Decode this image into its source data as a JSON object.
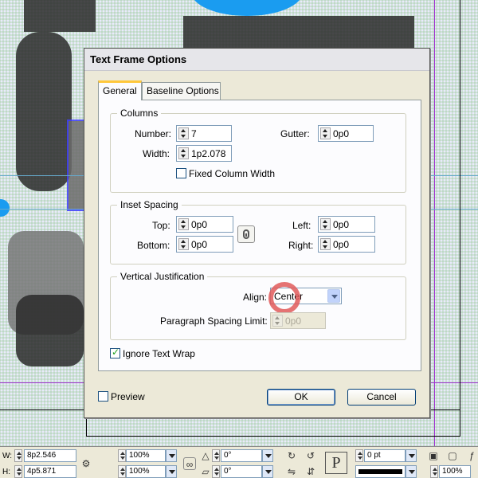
{
  "dialog": {
    "title": "Text Frame Options",
    "tabs": [
      {
        "label": "General",
        "active": true
      },
      {
        "label": "Baseline Options",
        "active": false
      }
    ],
    "columns": {
      "title": "Columns",
      "number_label": "Number:",
      "number_value": "7",
      "width_label": "Width:",
      "width_value": "1p2.078",
      "gutter_label": "Gutter:",
      "gutter_value": "0p0",
      "fixed_width_label": "Fixed Column Width",
      "fixed_width_checked": false
    },
    "inset": {
      "title": "Inset Spacing",
      "top_label": "Top:",
      "top_value": "0p0",
      "bottom_label": "Bottom:",
      "bottom_value": "0p0",
      "left_label": "Left:",
      "left_value": "0p0",
      "right_label": "Right:",
      "right_value": "0p0"
    },
    "vertical": {
      "title": "Vertical Justification",
      "align_label": "Align:",
      "align_value": "Center",
      "para_limit_label": "Paragraph Spacing Limit:",
      "para_limit_value": "0p0"
    },
    "ignore_wrap_label": "Ignore Text Wrap",
    "ignore_wrap_checked": true,
    "preview_label": "Preview",
    "preview_checked": false,
    "ok_label": "OK",
    "cancel_label": "Cancel"
  },
  "control_bar": {
    "w_label": "W:",
    "w_value": "8p2.546",
    "h_label": "H:",
    "h_value": "4p5.871",
    "scale_x": "100%",
    "scale_y": "100%",
    "rotate": "0°",
    "shear": "0°",
    "stroke_weight": "0 pt",
    "zoom": "100%"
  },
  "colors": {
    "accent_tab": "#ffc83c",
    "highlight_ring": "#e05a5a",
    "guide": "#a030d0"
  }
}
